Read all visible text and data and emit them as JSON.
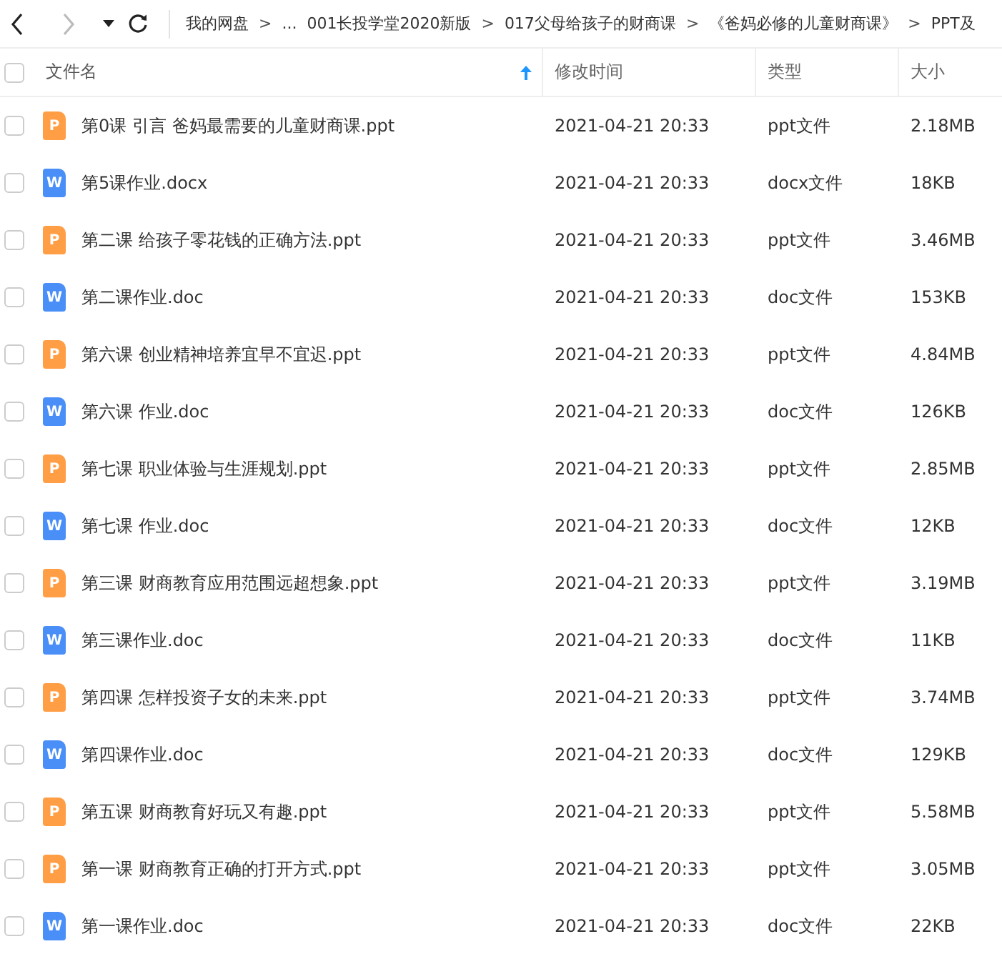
{
  "toolbar": {
    "back_enabled": true,
    "forward_enabled": false
  },
  "breadcrumb": [
    {
      "kind": "crumb",
      "text": "我的网盘"
    },
    {
      "kind": "separator",
      "text": ">"
    },
    {
      "kind": "crumb",
      "text": "..."
    },
    {
      "kind": "crumb",
      "text": "001长投学堂2020新版"
    },
    {
      "kind": "separator",
      "text": ">"
    },
    {
      "kind": "crumb",
      "text": "017父母给孩子的财商课"
    },
    {
      "kind": "separator",
      "text": ">"
    },
    {
      "kind": "crumb",
      "text": "《爸妈必修的儿童财商课》"
    },
    {
      "kind": "separator",
      "text": ">"
    },
    {
      "kind": "crumb",
      "text": "PPT及"
    }
  ],
  "table": {
    "select_all_checked": false,
    "columns": [
      {
        "label": "文件名",
        "sorted": true
      },
      {
        "label": "修改时间",
        "sorted": false
      },
      {
        "label": "类型",
        "sorted": false
      },
      {
        "label": "大小",
        "sorted": false
      }
    ],
    "rows": [
      {
        "kind": "ppt",
        "icon_letter": "P",
        "name": "第0课 引言 爸妈最需要的儿童财商课.ppt",
        "modified": "2021-04-21 20:33",
        "type": "ppt文件",
        "size": "2.18MB",
        "checked": false
      },
      {
        "kind": "doc",
        "icon_letter": "W",
        "name": "第5课作业.docx",
        "modified": "2021-04-21 20:33",
        "type": "docx文件",
        "size": "18KB",
        "checked": false
      },
      {
        "kind": "ppt",
        "icon_letter": "P",
        "name": "第二课 给孩子零花钱的正确方法.ppt",
        "modified": "2021-04-21 20:33",
        "type": "ppt文件",
        "size": "3.46MB",
        "checked": false
      },
      {
        "kind": "doc",
        "icon_letter": "W",
        "name": "第二课作业.doc",
        "modified": "2021-04-21 20:33",
        "type": "doc文件",
        "size": "153KB",
        "checked": false
      },
      {
        "kind": "ppt",
        "icon_letter": "P",
        "name": "第六课 创业精神培养宜早不宜迟.ppt",
        "modified": "2021-04-21 20:33",
        "type": "ppt文件",
        "size": "4.84MB",
        "checked": false
      },
      {
        "kind": "doc",
        "icon_letter": "W",
        "name": "第六课 作业.doc",
        "modified": "2021-04-21 20:33",
        "type": "doc文件",
        "size": "126KB",
        "checked": false
      },
      {
        "kind": "ppt",
        "icon_letter": "P",
        "name": "第七课 职业体验与生涯规划.ppt",
        "modified": "2021-04-21 20:33",
        "type": "ppt文件",
        "size": "2.85MB",
        "checked": false
      },
      {
        "kind": "doc",
        "icon_letter": "W",
        "name": "第七课 作业.doc",
        "modified": "2021-04-21 20:33",
        "type": "doc文件",
        "size": "12KB",
        "checked": false
      },
      {
        "kind": "ppt",
        "icon_letter": "P",
        "name": "第三课 财商教育应用范围远超想象.ppt",
        "modified": "2021-04-21 20:33",
        "type": "ppt文件",
        "size": "3.19MB",
        "checked": false
      },
      {
        "kind": "doc",
        "icon_letter": "W",
        "name": "第三课作业.doc",
        "modified": "2021-04-21 20:33",
        "type": "doc文件",
        "size": "11KB",
        "checked": false
      },
      {
        "kind": "ppt",
        "icon_letter": "P",
        "name": "第四课 怎样投资子女的未来.ppt",
        "modified": "2021-04-21 20:33",
        "type": "ppt文件",
        "size": "3.74MB",
        "checked": false
      },
      {
        "kind": "doc",
        "icon_letter": "W",
        "name": "第四课作业.doc",
        "modified": "2021-04-21 20:33",
        "type": "doc文件",
        "size": "129KB",
        "checked": false
      },
      {
        "kind": "ppt",
        "icon_letter": "P",
        "name": "第五课 财商教育好玩又有趣.ppt",
        "modified": "2021-04-21 20:33",
        "type": "ppt文件",
        "size": "5.58MB",
        "checked": false
      },
      {
        "kind": "ppt",
        "icon_letter": "P",
        "name": "第一课 财商教育正确的打开方式.ppt",
        "modified": "2021-04-21 20:33",
        "type": "ppt文件",
        "size": "3.05MB",
        "checked": false
      },
      {
        "kind": "doc",
        "icon_letter": "W",
        "name": "第一课作业.doc",
        "modified": "2021-04-21 20:33",
        "type": "doc文件",
        "size": "22KB",
        "checked": false
      }
    ]
  }
}
